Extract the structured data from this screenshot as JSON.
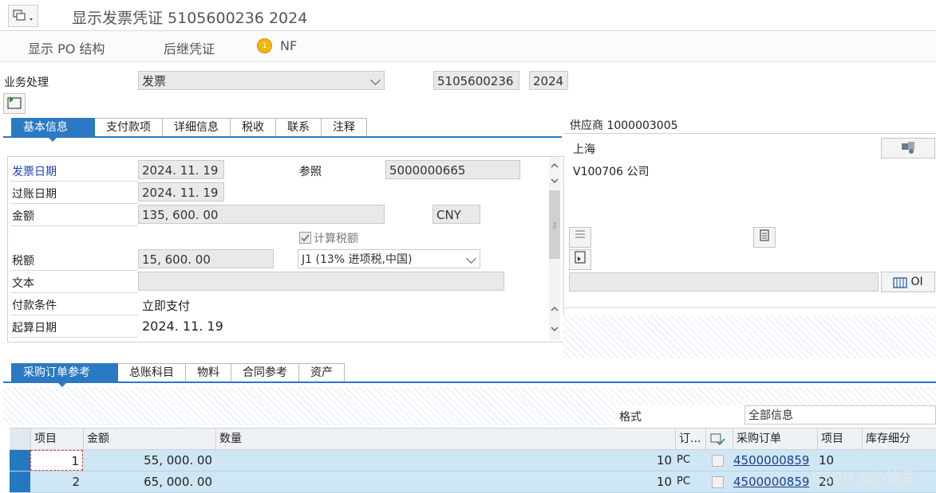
{
  "header": {
    "title": "显示发票凭证 5105600236 2024"
  },
  "toolbar": {
    "show_po_structure": "显示 PO 结构",
    "follow_on_docs": "后继凭证",
    "nf_badge": "1",
    "nf": "NF"
  },
  "transaction": {
    "label": "业务处理",
    "value": "发票",
    "doc_number": "5105600236",
    "fiscal_year": "2024"
  },
  "header_tabs": [
    "基本信息",
    "支付款项",
    "详细信息",
    "税收",
    "联系",
    "注释"
  ],
  "basic": {
    "invoice_date_label": "发票日期",
    "invoice_date": "2024. 11. 19",
    "reference_label": "参照",
    "reference": "5000000665",
    "posting_date_label": "过账日期",
    "posting_date": "2024. 11. 19",
    "amount_label": "金额",
    "amount": "135, 600. 00",
    "currency": "CNY",
    "calc_tax_label": "计算税额",
    "tax_label": "税额",
    "tax_amount": "15, 600. 00",
    "tax_code": "J1 (13% 进项税,中国)",
    "text_label": "文本",
    "text_value": "",
    "payment_terms_label": "付款条件",
    "payment_terms": "立即支付",
    "baseline_label": "起算日期",
    "baseline_date": "2024. 11. 19"
  },
  "vendor": {
    "title": "供应商 1000003005",
    "city": "上海",
    "name": "V100706 公司",
    "oi_label": "OI"
  },
  "item_tabs": [
    "采购订单参考",
    "总账科目",
    "物料",
    "合同参考",
    "资产"
  ],
  "layout_select": {
    "label": "格式",
    "value": "全部信息"
  },
  "grid": {
    "headers": [
      "项目",
      "金额",
      "数量",
      "订...",
      "采购订单",
      "项目",
      "库存细分"
    ],
    "rows": [
      {
        "item": "1",
        "amount": "55, 000. 00",
        "qty": "10",
        "unit": "PC",
        "po": "4500000859",
        "po_item": "10"
      },
      {
        "item": "2",
        "amount": "65, 000. 00",
        "qty": "10",
        "unit": "PC",
        "po": "4500000859",
        "po_item": "20"
      }
    ]
  },
  "watermark": "CSDN @心情豆",
  "colors": {
    "accent": "#2b79c2",
    "row_selected": "#cfe6f5",
    "label_blue": "#1f40b6"
  }
}
